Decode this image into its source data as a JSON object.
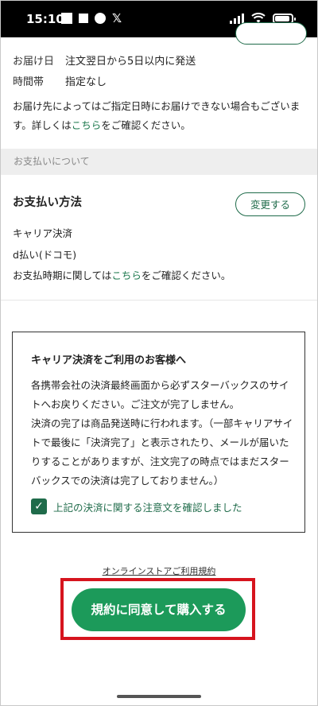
{
  "status_bar": {
    "time": "15:10",
    "social_icon": "𝕏"
  },
  "delivery": {
    "date_label": "お届け日",
    "date_value": "注文翌日から5日以内に発送",
    "time_label": "時間帯",
    "time_value": "指定なし",
    "note_prefix": "お届け先によってはご指定日時にお届けできない場合もございます。詳しくは",
    "note_link": "こちら",
    "note_suffix": "をご確認ください。"
  },
  "payment_section": {
    "header": "お支払いについて",
    "title": "お支払い方法",
    "change_button": "変更する",
    "method": "キャリア決済",
    "carrier": "d払い(ドコモ)",
    "timing_prefix": "お支払時期に関しては",
    "timing_link": "こちら",
    "timing_suffix": "をご確認ください。"
  },
  "notice": {
    "title": "キャリア決済をご利用のお客様へ",
    "body_1": "各携帯会社の決済最終画面から必ずスターバックスのサイトへお戻りください。ご注文が完了しません。",
    "body_2": "決済の完了は商品発送時に行われます。（一部キャリアサイトで最後に「決済完了」と表示されたり、メールが届いたりすることがありますが、注文完了の時点ではまだスターバックスでの決済は完了しておりません。）",
    "checkbox_label": "上記の決済に関する注意文を確認しました",
    "checkbox_checked": true
  },
  "footer": {
    "terms_link": "オンラインストアご利用規約",
    "buy_button": "規約に同意して購入する"
  },
  "colors": {
    "brand_green": "#1c9a5a",
    "dark_green": "#1f6b4a",
    "highlight_red": "#d6141e"
  }
}
